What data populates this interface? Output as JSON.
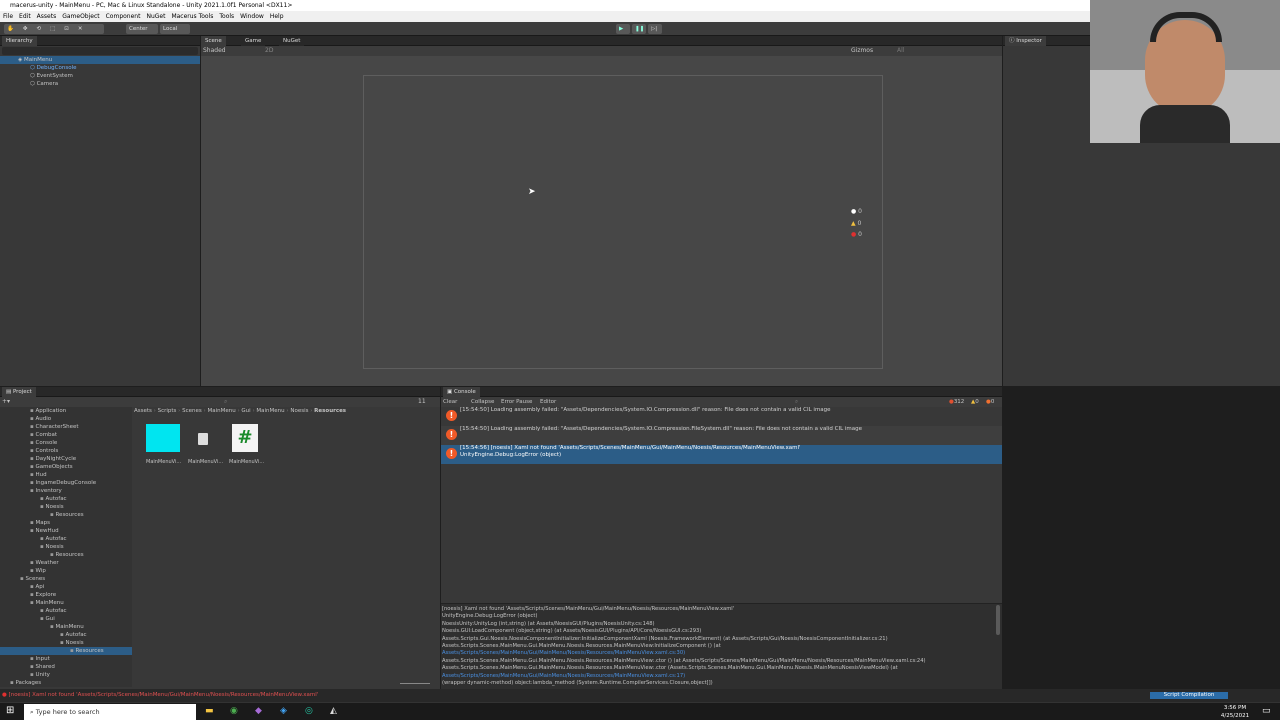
{
  "window": {
    "title": "macerus-unity - MainMenu - PC, Mac & Linux Standalone - Unity 2021.1.0f1 Personal <DX11>"
  },
  "menu": [
    "File",
    "Edit",
    "Assets",
    "GameObject",
    "Component",
    "NuGet",
    "Macerus Tools",
    "Tools",
    "Window",
    "Help"
  ],
  "toolbar": {
    "center": "Center",
    "local": "Local"
  },
  "hierarchy": {
    "tab": "Hierarchy",
    "scene": "MainMenu",
    "items": [
      "DebugConsole",
      "EventSystem",
      "Camera"
    ]
  },
  "scene_view": {
    "tabs": [
      "Scene",
      "Game",
      "NuGet"
    ],
    "shading": "Shaded",
    "mode2d": "2D",
    "gizmos": "Gizmos",
    "search_all": "All",
    "counters": [
      "0",
      "0",
      "0"
    ]
  },
  "inspector": {
    "tab": "Inspector"
  },
  "project": {
    "tab": "Project",
    "tree": [
      {
        "label": "Application",
        "depth": 3
      },
      {
        "label": "Audio",
        "depth": 3
      },
      {
        "label": "CharacterSheet",
        "depth": 3
      },
      {
        "label": "Combat",
        "depth": 3
      },
      {
        "label": "Console",
        "depth": 3
      },
      {
        "label": "Controls",
        "depth": 3
      },
      {
        "label": "DayNightCycle",
        "depth": 3
      },
      {
        "label": "GameObjects",
        "depth": 3
      },
      {
        "label": "Hud",
        "depth": 3
      },
      {
        "label": "IngameDebugConsole",
        "depth": 3
      },
      {
        "label": "Inventory",
        "depth": 3
      },
      {
        "label": "Autofac",
        "depth": 4
      },
      {
        "label": "Noesis",
        "depth": 4
      },
      {
        "label": "Resources",
        "depth": 5
      },
      {
        "label": "Maps",
        "depth": 3
      },
      {
        "label": "NewHud",
        "depth": 3
      },
      {
        "label": "Autofac",
        "depth": 4
      },
      {
        "label": "Noesis",
        "depth": 4
      },
      {
        "label": "Resources",
        "depth": 5
      },
      {
        "label": "Weather",
        "depth": 3
      },
      {
        "label": "Wip",
        "depth": 3
      },
      {
        "label": "Scenes",
        "depth": 2
      },
      {
        "label": "Api",
        "depth": 3
      },
      {
        "label": "Explore",
        "depth": 3
      },
      {
        "label": "MainMenu",
        "depth": 3
      },
      {
        "label": "Autofac",
        "depth": 4
      },
      {
        "label": "Gui",
        "depth": 4
      },
      {
        "label": "MainMenu",
        "depth": 5
      },
      {
        "label": "Autofac",
        "depth": 6
      },
      {
        "label": "Noesis",
        "depth": 6
      },
      {
        "label": "Resources",
        "depth": 7
      },
      {
        "label": "Input",
        "depth": 3
      },
      {
        "label": "Shared",
        "depth": 3
      },
      {
        "label": "Unity",
        "depth": 3
      },
      {
        "label": "Packages",
        "depth": 1
      }
    ],
    "breadcrumb": [
      "Assets",
      "Scripts",
      "Scenes",
      "MainMenu",
      "Gui",
      "MainMenu",
      "Noesis",
      "Resources"
    ],
    "assets": [
      "MainMenuVi...",
      "MainMenuVi...",
      "MainMenuVi..."
    ],
    "asset_count": "11"
  },
  "console": {
    "tab": "Console",
    "toolbar": [
      "Clear",
      "Collapse",
      "Error Pause",
      "Editor"
    ],
    "counts": {
      "errors": "312",
      "warnings": "0",
      "messages": "0"
    },
    "rows": [
      {
        "line1": "[15:54:50] Loading assembly failed: \"Assets/Dependencies/System.IO.Compression.dll\" reason: File does not contain a valid CIL image",
        "line2": ""
      },
      {
        "line1": "[15:54:50] Loading assembly failed: \"Assets/Dependencies/System.IO.Compression.FileSystem.dll\" reason: File does not contain a valid CIL image",
        "line2": ""
      },
      {
        "line1": "[15:54:56] [noesis] Xaml not found 'Assets/Scripts/Scenes/MainMenu/Gui/MainMenu/Noesis/Resources/MainMenuView.xaml'",
        "line2": "UnityEngine.Debug:LogError (object)"
      }
    ],
    "detail": [
      "[noesis] Xaml not found 'Assets/Scripts/Scenes/MainMenu/Gui/MainMenu/Noesis/Resources/MainMenuView.xaml'",
      "UnityEngine.Debug:LogError (object)",
      "NoesisUnity:UnityLog (int,string) (at Assets/NoesisGUI/Plugins/NoesisUnity.cs:148)",
      "Noesis.GUI:LoadComponent (object,string) (at Assets/NoesisGUI/Plugins/API/Core/NoesisGUI.cs:293)",
      "Assets.Scripts.Gui.Noesis.NoesisComponentInitializer:InitializeComponentXaml (Noesis.FrameworkElement) (at Assets/Scripts/Gui/Noesis/NoesisComponentInitializer.cs:21)",
      "Assets.Scripts.Scenes.MainMenu.Gui.MainMenu.Noesis.Resources.MainMenuView:InitializeComponent () (at",
      "Assets/Scripts/Scenes/MainMenu/Gui/MainMenu/Noesis/Resources/MainMenuView.xaml.cs:30)",
      "Assets.Scripts.Scenes.MainMenu.Gui.MainMenu.Noesis.Resources.MainMenuView:.ctor () (at Assets/Scripts/Scenes/MainMenu/Gui/MainMenu/Noesis/Resources/MainMenuView.xaml.cs:24)",
      "Assets.Scripts.Scenes.MainMenu.Gui.MainMenu.Noesis.Resources.MainMenuView:.ctor (Assets.Scripts.Scenes.MainMenu.Gui.MainMenu.Noesis.IMainMenuNoesisViewModel) (at",
      "Assets/Scripts/Scenes/MainMenu/Gui/MainMenu/Noesis/Resources/MainMenuView.xaml.cs:17)",
      "(wrapper dynamic-method) object:lambda_method (System.Runtime.CompilerServices.Closure,object[])"
    ]
  },
  "statusbar": {
    "message": "[noesis] Xaml not found 'Assets/Scripts/Scenes/MainMenu/Gui/MainMenu/Noesis/Resources/MainMenuView.xaml'",
    "script_compilation": "Script Compilation"
  },
  "taskbar": {
    "search_placeholder": "Type here to search",
    "time": "3:56 PM",
    "date": "4/25/2021"
  }
}
